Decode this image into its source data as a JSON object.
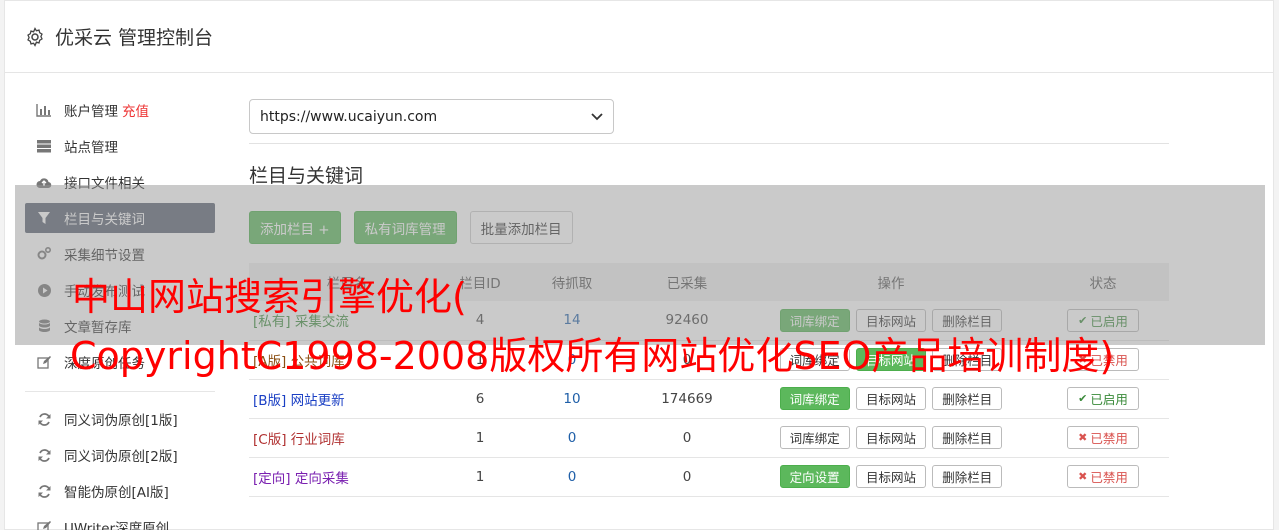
{
  "header": {
    "title": "优采云 管理控制台",
    "icon": "gear-icon"
  },
  "sidebar": {
    "items": [
      {
        "label": "账户管理",
        "extra": "充值",
        "icon": "bar-chart-icon"
      },
      {
        "label": "站点管理",
        "icon": "server-icon"
      },
      {
        "label": "接口文件相关",
        "icon": "cloud-upload-icon"
      },
      {
        "label": "栏目与关键词",
        "icon": "filter-icon",
        "active": true
      },
      {
        "label": "采集细节设置",
        "icon": "cogs-icon"
      },
      {
        "label": "手动发布测试",
        "icon": "play-circle-icon"
      },
      {
        "label": "文章暂存库",
        "icon": "database-icon"
      },
      {
        "label": "深度原创任务",
        "icon": "edit-icon"
      }
    ],
    "items2": [
      {
        "label": "同义词伪原创[1版]",
        "icon": "refresh-icon"
      },
      {
        "label": "同义词伪原创[2版]",
        "icon": "refresh-icon"
      },
      {
        "label": "智能伪原创[AI版]",
        "icon": "refresh-icon"
      },
      {
        "label": "UWriter深度原创",
        "icon": "edit-icon"
      }
    ]
  },
  "site_select": {
    "value": "https://www.ucaiyun.com"
  },
  "section": {
    "title": "栏目与关键词"
  },
  "toolbar": {
    "add_column": "添加栏目 +",
    "private_lib": "私有词库管理",
    "batch_add": "批量添加栏目"
  },
  "table": {
    "headers": [
      "栏目名",
      "栏目ID",
      "待抓取",
      "已采集",
      "操作",
      "状态"
    ],
    "rows": [
      {
        "tag": "[私有]",
        "name": "采集交流",
        "id": "4",
        "pending": "14",
        "collected": "92460",
        "op1": "词库绑定",
        "op2": "目标网站",
        "op3": "删除栏目",
        "status": "已启用"
      },
      {
        "tag": "[A版]",
        "name": "公共词库",
        "id": "1",
        "pending": "0",
        "collected": "0",
        "op1": "词库绑定",
        "op2": "目标网站",
        "op3": "删除栏目",
        "status": "已禁用"
      },
      {
        "tag": "[B版]",
        "name": "网站更新",
        "id": "6",
        "pending": "10",
        "collected": "174669",
        "op1": "词库绑定",
        "op2": "目标网站",
        "op3": "删除栏目",
        "status": "已启用"
      },
      {
        "tag": "[C版]",
        "name": "行业词库",
        "id": "1",
        "pending": "0",
        "collected": "0",
        "op1": "词库绑定",
        "op2": "目标网站",
        "op3": "删除栏目",
        "status": "已禁用"
      },
      {
        "tag": "[定向]",
        "name": "定向采集",
        "id": "1",
        "pending": "0",
        "collected": "0",
        "op1": "定向设置",
        "op2": "目标网站",
        "op3": "删除栏目",
        "status": "已禁用"
      }
    ]
  },
  "watermark": {
    "line1": "中山网站搜索引擎优化(",
    "line2": "CopyrightC1998-2008版权所有网站优化SEO产品培训制度)"
  }
}
